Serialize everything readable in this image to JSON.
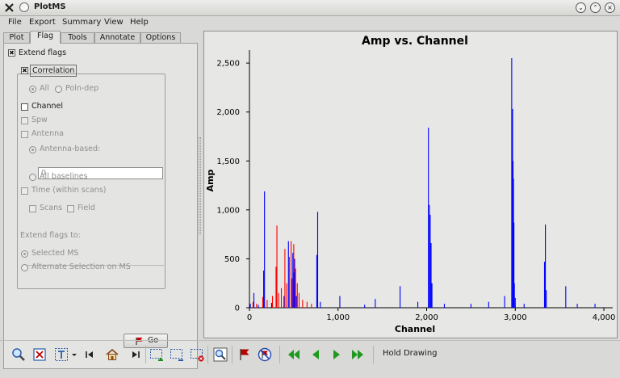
{
  "window": {
    "title": "PlotMS"
  },
  "menu": [
    "File",
    "Export",
    "Summary",
    "View",
    "Help"
  ],
  "tabs": [
    "Plot",
    "Flag",
    "Tools",
    "Annotate",
    "Options"
  ],
  "flag": {
    "extend_flags": "Extend flags",
    "correlation": "Correlation",
    "all": "All",
    "poln_dep": "Poln-dep",
    "channel": "Channel",
    "spw": "Spw",
    "antenna": "Antenna",
    "antenna_based": "Antenna-based:",
    "antenna_value": "0",
    "all_baselines": "All baselines",
    "time": "Time (within scans)",
    "scans": "Scans",
    "field": "Field",
    "extend_to": "Extend flags to:",
    "selected_ms": "Selected MS",
    "alternate": "Alternate Selection on MS",
    "go": "Go"
  },
  "toolbar": {
    "hold": "Hold Drawing"
  },
  "chart_data": {
    "type": "scatter",
    "title": "Amp vs. Channel",
    "xlabel": "Channel",
    "ylabel": "Amp",
    "xlim": [
      0,
      4100
    ],
    "ylim": [
      0,
      2600
    ],
    "xticks": [
      0,
      1000,
      2000,
      3000,
      4000
    ],
    "xtick_labels": [
      "0",
      "1,000",
      "2,000",
      "3,000",
      "4,000"
    ],
    "yticks": [
      0,
      500,
      1000,
      1500,
      2000,
      2500
    ],
    "ytick_labels": [
      "0",
      "500",
      "1,000",
      "1,500",
      "2,000",
      "2,500"
    ],
    "grid": false,
    "series": [
      {
        "color": "#ff0000",
        "points": [
          [
            40,
            60
          ],
          [
            80,
            40
          ],
          [
            150,
            110
          ],
          [
            200,
            80
          ],
          [
            260,
            120
          ],
          [
            300,
            420
          ],
          [
            310,
            840
          ],
          [
            330,
            150
          ],
          [
            360,
            200
          ],
          [
            400,
            600
          ],
          [
            420,
            250
          ],
          [
            450,
            520
          ],
          [
            470,
            680
          ],
          [
            480,
            300
          ],
          [
            500,
            650
          ],
          [
            520,
            400
          ],
          [
            540,
            250
          ],
          [
            560,
            150
          ],
          [
            600,
            80
          ],
          [
            650,
            60
          ],
          [
            700,
            40
          ]
        ]
      },
      {
        "color": "#0000ff",
        "points": [
          [
            10,
            40
          ],
          [
            50,
            150
          ],
          [
            100,
            30
          ],
          [
            160,
            380
          ],
          [
            170,
            1190
          ],
          [
            250,
            50
          ],
          [
            390,
            120
          ],
          [
            440,
            680
          ],
          [
            490,
            560
          ],
          [
            500,
            360
          ],
          [
            510,
            500
          ],
          [
            530,
            120
          ],
          [
            760,
            540
          ],
          [
            770,
            980
          ],
          [
            800,
            60
          ],
          [
            1020,
            120
          ],
          [
            1300,
            30
          ],
          [
            1420,
            90
          ],
          [
            1700,
            220
          ],
          [
            1900,
            60
          ],
          [
            2020,
            1840
          ],
          [
            2030,
            1050
          ],
          [
            2040,
            950
          ],
          [
            2050,
            660
          ],
          [
            2060,
            250
          ],
          [
            2200,
            40
          ],
          [
            2500,
            40
          ],
          [
            2700,
            60
          ],
          [
            2880,
            120
          ],
          [
            2960,
            2550
          ],
          [
            2970,
            2030
          ],
          [
            2975,
            1500
          ],
          [
            2980,
            1320
          ],
          [
            2985,
            870
          ],
          [
            2990,
            250
          ],
          [
            3000,
            100
          ],
          [
            3100,
            40
          ],
          [
            3330,
            470
          ],
          [
            3340,
            850
          ],
          [
            3350,
            180
          ],
          [
            3570,
            220
          ],
          [
            3700,
            40
          ],
          [
            3900,
            40
          ]
        ]
      }
    ]
  }
}
